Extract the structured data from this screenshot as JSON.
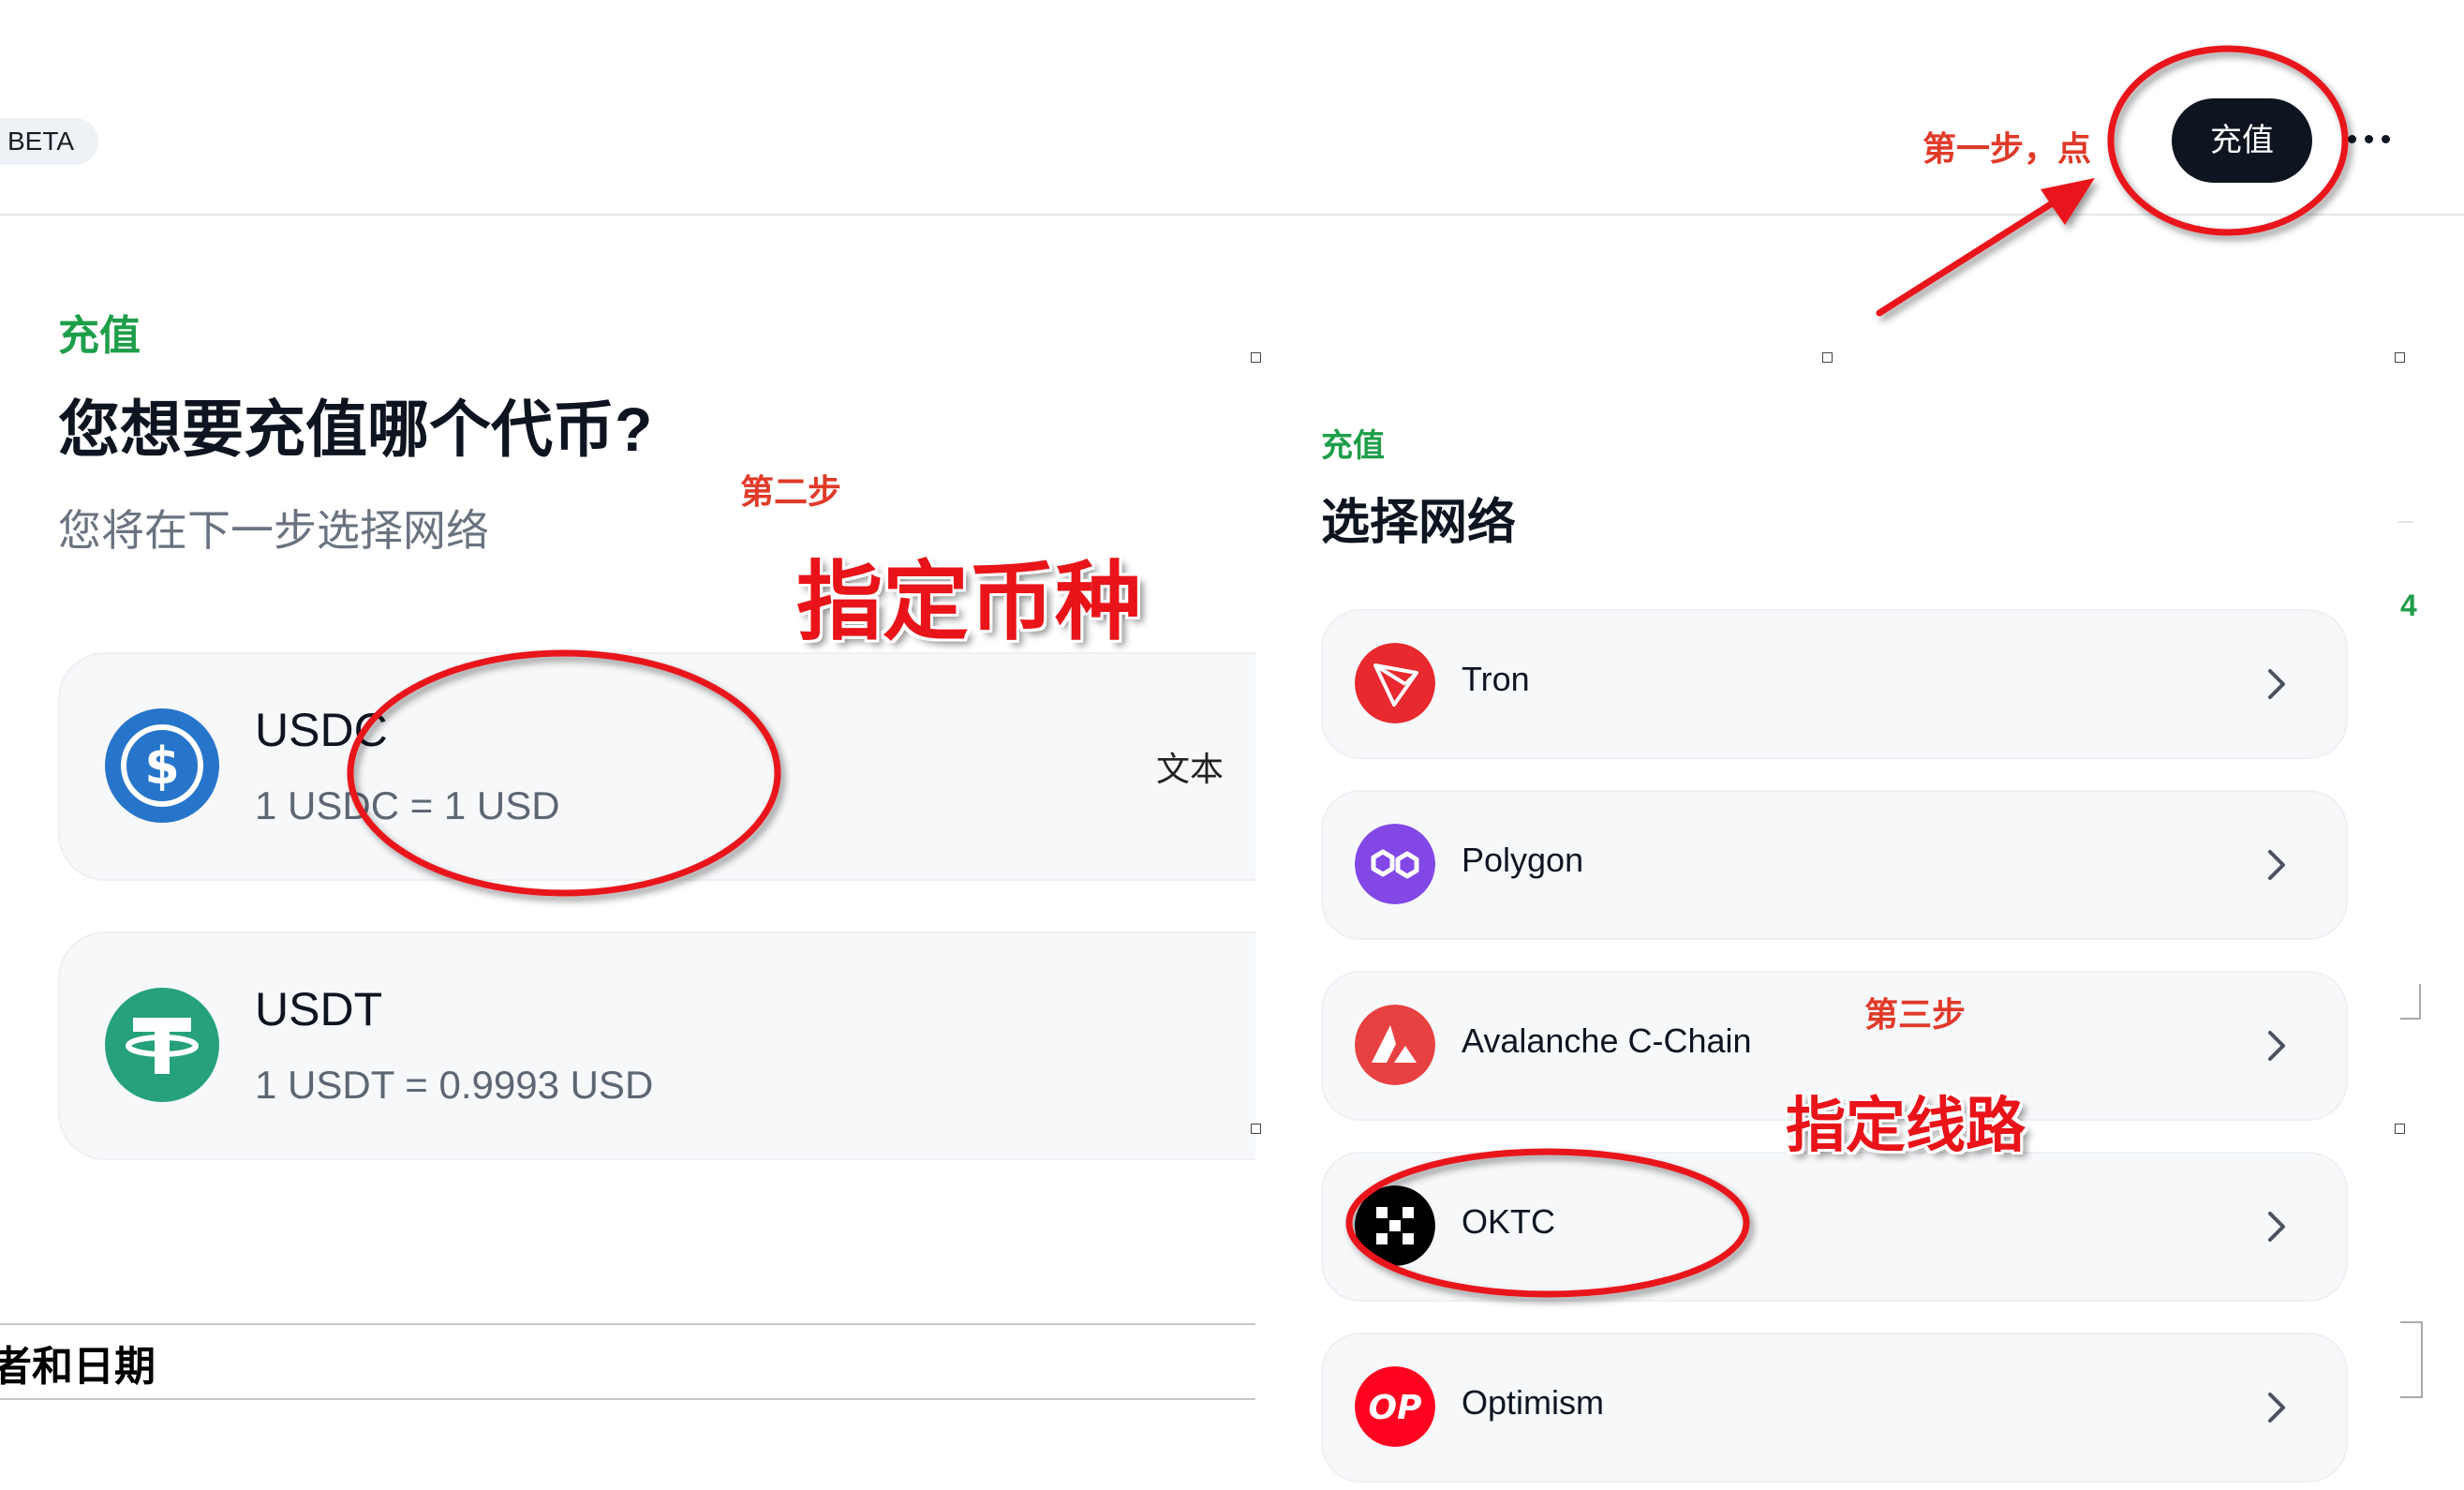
{
  "header": {
    "beta_badge": "BETA",
    "deposit_button": "充值",
    "more_icon": "more-horizontal-icon"
  },
  "left_panel": {
    "kicker": "充值",
    "title": "您想要充值哪个代币?",
    "subtitle": "您将在下一步选择网络",
    "coins": [
      {
        "name": "USDC",
        "rate": "1 USDC = 1 USD",
        "extra": "文本",
        "icon": "usdc-icon"
      },
      {
        "name": "USDT",
        "rate": "1 USDT = 0.9993 USD",
        "icon": "usdt-icon"
      }
    ],
    "bottom_text": "者和日期"
  },
  "right_panel": {
    "kicker": "充值",
    "title": "选择网络",
    "networks": [
      {
        "name": "Tron",
        "icon": "tron-icon",
        "color": "#e8292f"
      },
      {
        "name": "Polygon",
        "icon": "polygon-icon",
        "color": "#8247e5"
      },
      {
        "name": "Avalanche C-Chain",
        "icon": "avalanche-icon",
        "color": "#e84142"
      },
      {
        "name": "OKTC",
        "icon": "oktc-icon",
        "color": "#000000"
      },
      {
        "name": "Optimism",
        "icon": "optimism-icon",
        "color": "#ff0420"
      }
    ],
    "side_number": "4"
  },
  "annotations": {
    "step1": "第一步，点",
    "step2": "第二步",
    "step2_big": "指定币种",
    "step3": "第三步",
    "step3_big": "指定线路"
  },
  "colors": {
    "accent_green": "#1f9e4a",
    "dark_button": "#0e1521",
    "annotation_red": "#e8141a"
  }
}
